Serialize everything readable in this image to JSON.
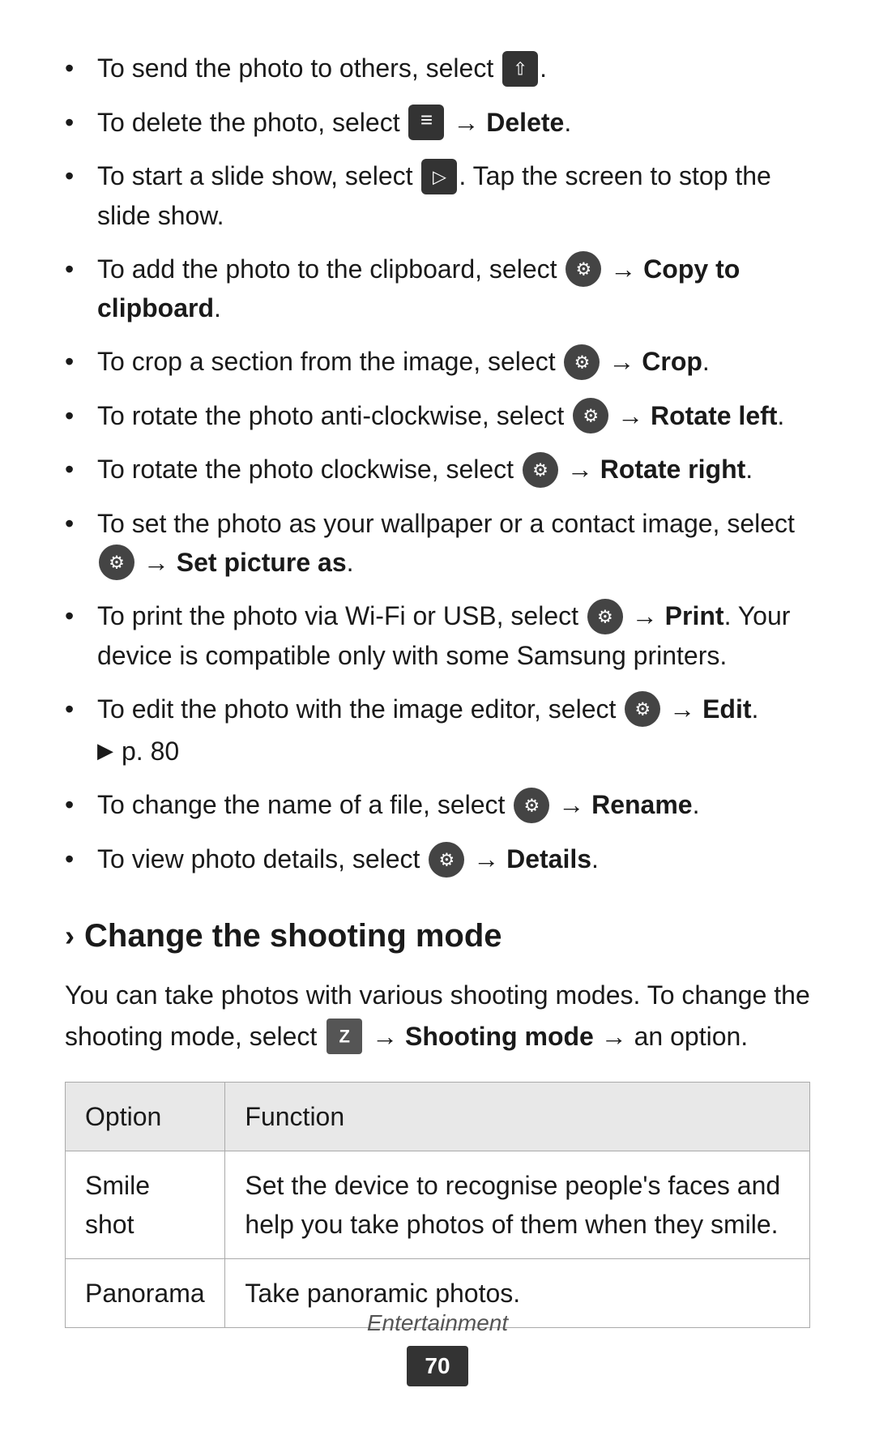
{
  "page": {
    "bullets": [
      {
        "id": "send",
        "text_before": "To send the photo to others, select",
        "icon": "share",
        "text_after": ".",
        "bold_part": null
      },
      {
        "id": "delete",
        "text_before": "To delete the photo, select",
        "icon": "menu",
        "arrow": "→",
        "bold_part": "Delete",
        "text_after": "."
      },
      {
        "id": "slideshow",
        "text_before": "To start a slide show, select",
        "icon": "slide",
        "text_after": ". Tap the screen to stop the slide show.",
        "bold_part": null
      },
      {
        "id": "clipboard",
        "text_before": "To add the photo to the clipboard, select",
        "icon": "options",
        "arrow": "→",
        "bold_part": "Copy to clipboard",
        "text_after": "."
      },
      {
        "id": "crop",
        "text_before": "To crop a section from the image, select",
        "icon": "options",
        "arrow": "→",
        "bold_part": "Crop",
        "text_after": "."
      },
      {
        "id": "rotate_left",
        "text_before": "To rotate the photo anti-clockwise, select",
        "icon": "options",
        "arrow": "→",
        "bold_part": "Rotate left",
        "text_after": "."
      },
      {
        "id": "rotate_right",
        "text_before": "To rotate the photo clockwise, select",
        "icon": "options",
        "arrow": "→",
        "bold_part": "Rotate right",
        "text_after": "."
      },
      {
        "id": "set_picture",
        "text_before": "To set the photo as your wallpaper or a contact image, select",
        "icon": "options",
        "arrow": "→",
        "bold_part": "Set picture as",
        "text_after": "."
      },
      {
        "id": "print",
        "text_before": "To print the photo via Wi-Fi or USB, select",
        "icon": "options",
        "arrow": "→",
        "bold_part": "Print",
        "text_after": ". Your device is compatible only with some Samsung printers."
      },
      {
        "id": "edit",
        "text_before": "To edit the photo with the image editor, select",
        "icon": "options",
        "arrow": "→",
        "bold_part": "Edit",
        "text_after": ".",
        "sub_ref": "► p. 80"
      },
      {
        "id": "rename",
        "text_before": "To change the name of a file, select",
        "icon": "options",
        "arrow": "→",
        "bold_part": "Rename",
        "text_after": "."
      },
      {
        "id": "details",
        "text_before": "To view photo details, select",
        "icon": "options",
        "arrow": "→",
        "bold_part": "Details",
        "text_after": "."
      }
    ],
    "section": {
      "chevron": "›",
      "title": "Change the shooting mode",
      "description_1": "You can take photos with various shooting modes. To change the shooting mode, select",
      "description_icon": "mode",
      "description_arrow": "→",
      "description_bold": "Shooting mode",
      "description_2": "→ an option.",
      "table": {
        "headers": [
          "Option",
          "Function"
        ],
        "rows": [
          {
            "option": "Smile shot",
            "function": "Set the device to recognise people's faces and help you take photos of them when they smile."
          },
          {
            "option": "Panorama",
            "function": "Take panoramic photos."
          }
        ]
      }
    },
    "footer": {
      "label": "Entertainment",
      "page": "70"
    }
  }
}
